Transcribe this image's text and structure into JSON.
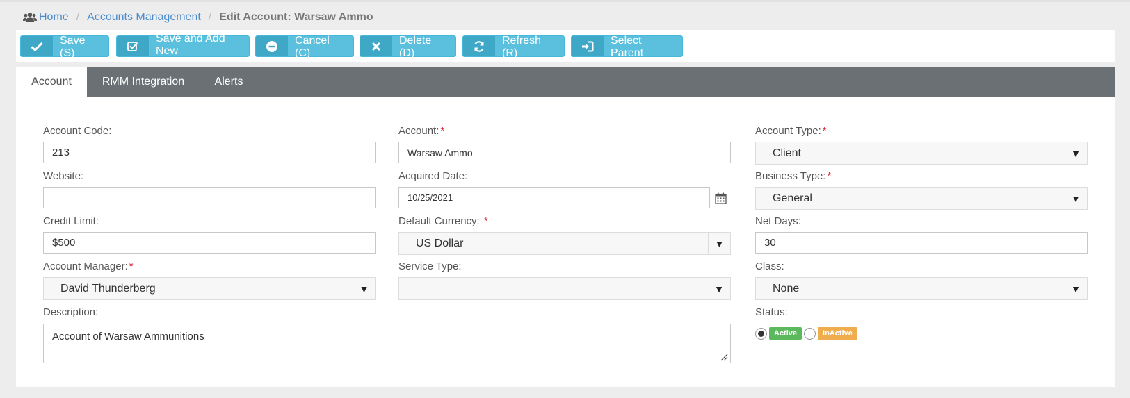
{
  "breadcrumb": {
    "home": "Home",
    "accounts": "Accounts Management",
    "current": "Edit Account: Warsaw Ammo"
  },
  "toolbar": {
    "save": "Save (S)",
    "save_add_new": "Save and Add New",
    "cancel": "Cancel (C)",
    "delete": "Delete (D)",
    "refresh": "Refresh (R)",
    "select_parent": "Select Parent"
  },
  "tabs": [
    {
      "label": "Account"
    },
    {
      "label": "RMM Integration"
    },
    {
      "label": "Alerts"
    }
  ],
  "form": {
    "account_code": {
      "label": "Account Code:",
      "value": "213"
    },
    "website": {
      "label": "Website:",
      "value": ""
    },
    "credit_limit": {
      "label": "Credit Limit:",
      "value": "$500"
    },
    "account_manager": {
      "label": "Account Manager:",
      "value": "David Thunderberg"
    },
    "description": {
      "label": "Description:",
      "value": "Account of Warsaw Ammunitions"
    },
    "account": {
      "label": "Account:",
      "value": "Warsaw Ammo"
    },
    "acquired_date": {
      "label": "Acquired Date:",
      "value": "10/25/2021"
    },
    "default_currency": {
      "label": "Default Currency:",
      "value": "US Dollar"
    },
    "service_type": {
      "label": "Service Type:",
      "value": ""
    },
    "account_type": {
      "label": "Account Type:",
      "value": "Client"
    },
    "business_type": {
      "label": "Business Type:",
      "value": "General"
    },
    "net_days": {
      "label": "Net Days:",
      "value": "30"
    },
    "class": {
      "label": "Class:",
      "value": "None"
    },
    "status": {
      "label": "Status:",
      "active": "Active",
      "inactive": "InActive",
      "selected": "Active"
    },
    "required_mark": "*"
  },
  "colors": {
    "accent": "#5bc0de",
    "tabbar": "#6a7074",
    "link": "#4a8ccc",
    "required": "#d9222a",
    "active_badge": "#5cb85c",
    "inactive_badge": "#f0ad4e"
  },
  "icons": {
    "home": "users-icon",
    "save": "check-icon",
    "save_add_new": "check-square-icon",
    "cancel": "minus-circle-icon",
    "delete": "x-icon",
    "refresh": "refresh-icon",
    "select_parent": "sign-in-icon",
    "calendar": "calendar-icon"
  }
}
